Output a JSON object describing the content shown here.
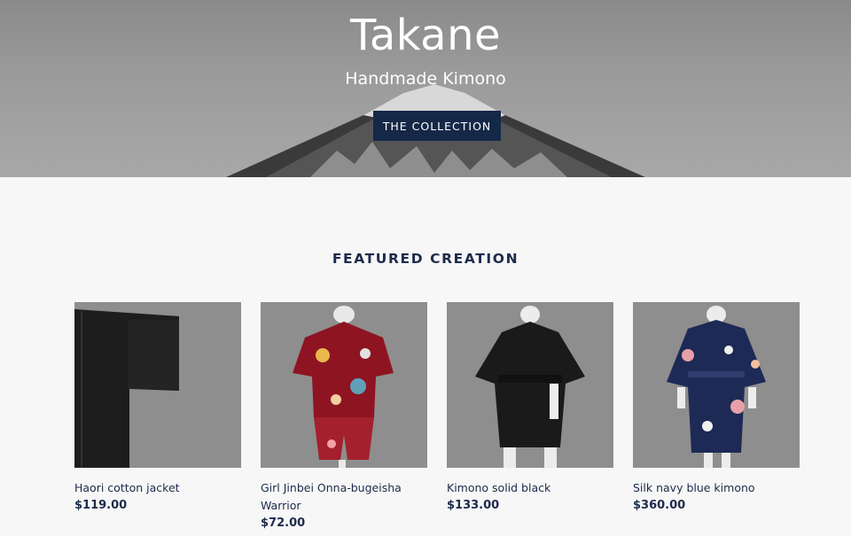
{
  "hero": {
    "title": "Takane",
    "subtitle": "Handmade Kimono",
    "button_label": "THE COLLECTION"
  },
  "featured": {
    "title": "FEATURED CREATION",
    "products": [
      {
        "name": "Haori cotton jacket",
        "price": "$119.00",
        "image": "black-haori-jacket"
      },
      {
        "name": "Girl Jinbei Onna-bugeisha Warrior",
        "price": "$72.00",
        "image": "red-floral-jinbei"
      },
      {
        "name": "Kimono solid black",
        "price": "$133.00",
        "image": "black-kimono-mannequin"
      },
      {
        "name": "Silk navy blue kimono",
        "price": "$360.00",
        "image": "navy-floral-kimono"
      }
    ]
  },
  "colors": {
    "accent": "#152848",
    "text": "#1c2b4a",
    "background": "#f7f7f7",
    "image_background": "#8e8e8e"
  }
}
